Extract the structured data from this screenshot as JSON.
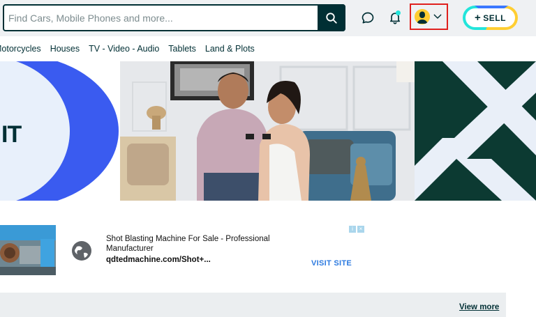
{
  "header": {
    "search": {
      "placeholder": "Find Cars, Mobile Phones and more...",
      "value": ""
    },
    "icons": {
      "search": "search-icon",
      "chat": "chat-icon",
      "notifications": "bell-icon",
      "profile_dropdown": "chevron-down-icon"
    },
    "sell_label": "SELL",
    "sell_plus": "+"
  },
  "categories": [
    "Motorcycles",
    "Houses",
    "TV - Video - Audio",
    "Tablets",
    "Land & Plots"
  ],
  "banner": {
    "left_text": "IT"
  },
  "ad": {
    "title": "Shot Blasting Machine For Sale - Professional Manufacturer",
    "url": "qdtedmachine.com/Shot+...",
    "cta": "VISIT SITE"
  },
  "section": {
    "view_more": "View more"
  },
  "colors": {
    "brand_dark": "#002f34",
    "accent_teal": "#23e5db",
    "accent_blue": "#3a77ff",
    "accent_yellow": "#ffce32",
    "highlight_red": "#e0201d",
    "link_blue": "#2c7ae0"
  }
}
